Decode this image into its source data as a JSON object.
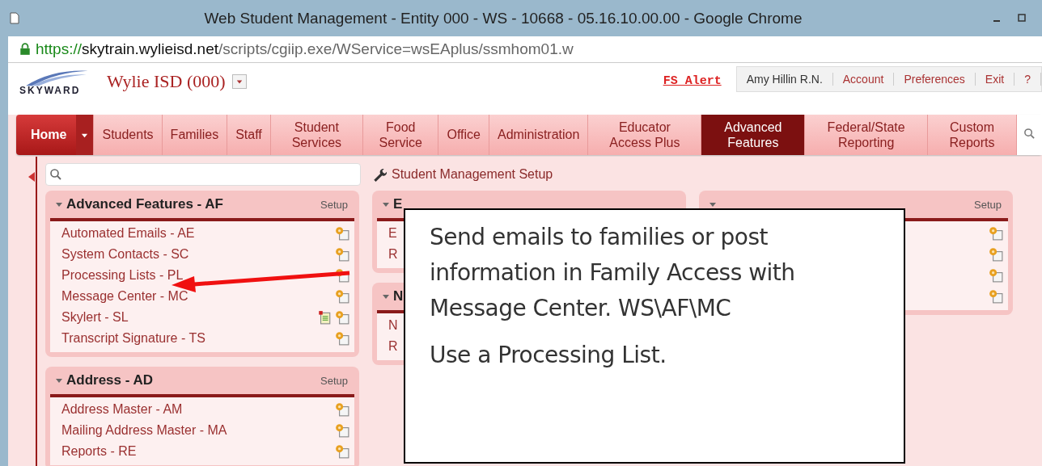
{
  "window": {
    "title": "Web Student Management - Entity 000 - WS - 10668 - 05.16.10.00.00 - Google Chrome"
  },
  "address_bar": {
    "scheme": "https://",
    "host": "skytrain.wylieisd.net",
    "path": "/scripts/cgiip.exe/WService=wsEAplus/ssmhom01.w"
  },
  "header": {
    "logo": "SKYWARD",
    "district": "Wylie ISD (000)",
    "alert": "FS Alert",
    "user_links": [
      "Amy Hillin R.N.",
      "Account",
      "Preferences",
      "Exit",
      "?"
    ]
  },
  "nav_tabs": [
    {
      "label": "Home",
      "selected": false,
      "kind": "home"
    },
    {
      "label": "Students",
      "selected": false,
      "kind": "tab"
    },
    {
      "label": "Families",
      "selected": false,
      "kind": "tab"
    },
    {
      "label": "Staff",
      "selected": false,
      "kind": "tab"
    },
    {
      "label": "Student Services",
      "selected": false,
      "kind": "tab"
    },
    {
      "label": "Food Service",
      "selected": false,
      "kind": "tab"
    },
    {
      "label": "Office",
      "selected": false,
      "kind": "tab"
    },
    {
      "label": "Administration",
      "selected": false,
      "kind": "tab"
    },
    {
      "label": "Educator Access Plus",
      "selected": false,
      "kind": "tab"
    },
    {
      "label": "Advanced Features",
      "selected": true,
      "kind": "tab"
    },
    {
      "label": "Federal/State Reporting",
      "selected": false,
      "kind": "tab"
    },
    {
      "label": "Custom Reports",
      "selected": false,
      "kind": "tab"
    }
  ],
  "setup_link": "Student Management Setup",
  "columns": [
    [
      {
        "title": "Advanced Features - AF",
        "setup": "Setup",
        "items": [
          {
            "label": "Automated Emails - AE",
            "extra_icon": false
          },
          {
            "label": "System Contacts - SC",
            "extra_icon": false
          },
          {
            "label": "Processing Lists - PL",
            "extra_icon": false
          },
          {
            "label": "Message Center - MC",
            "extra_icon": false
          },
          {
            "label": "Skylert - SL",
            "extra_icon": true
          },
          {
            "label": "Transcript Signature - TS",
            "extra_icon": false
          }
        ]
      },
      {
        "title": "Address - AD",
        "setup": "Setup",
        "items": [
          {
            "label": "Address Master - AM",
            "extra_icon": false
          },
          {
            "label": "Mailing Address Master - MA",
            "extra_icon": false
          },
          {
            "label": "Reports - RE",
            "extra_icon": false
          }
        ]
      }
    ],
    [
      {
        "title": "E",
        "items": [
          {
            "label": "E"
          },
          {
            "label": "R"
          }
        ]
      },
      {
        "title": "N",
        "items": [
          {
            "label": "N"
          },
          {
            "label": "R"
          }
        ]
      }
    ],
    [
      {
        "setup": "Setup",
        "items": [
          {
            "extra_icon": false
          },
          {
            "extra_icon": false
          },
          {
            "extra_icon": false
          },
          {
            "extra_icon": false
          }
        ]
      }
    ]
  ],
  "callout": {
    "paragraphs": [
      "Send emails to families or post information in Family Access with Message Center. WS\\AF\\MC",
      "Use a Processing List."
    ]
  }
}
